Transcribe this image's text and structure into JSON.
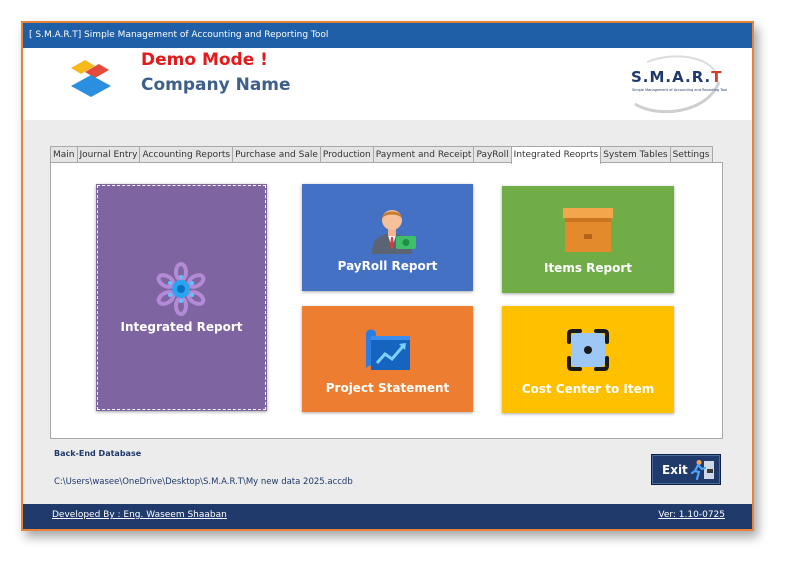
{
  "window": {
    "title": "[ S.M.A.R.T] Simple Management of Accounting and Reporting Tool"
  },
  "header": {
    "demo_text": "Demo Mode !",
    "company_name": "Company Name",
    "brand_logo_text": "S.M.A.R.T",
    "brand_logo_subtitle": "Simple Management of Accounting and Reporting Tool"
  },
  "tabs": [
    {
      "label": "Main"
    },
    {
      "label": "Journal Entry"
    },
    {
      "label": "Accounting Reports"
    },
    {
      "label": "Purchase and Sale"
    },
    {
      "label": "Production"
    },
    {
      "label": "Payment and Receipt"
    },
    {
      "label": "PayRoll"
    },
    {
      "label": "Integrated Reoprts",
      "active": true
    },
    {
      "label": "System Tables"
    },
    {
      "label": "Settings"
    }
  ],
  "tiles": {
    "integrated_report": {
      "label": "Integrated Report",
      "color": "#7e64a0",
      "icon": "flower-network-icon"
    },
    "payroll_report": {
      "label": "PayRoll Report",
      "color": "#4471c4",
      "icon": "person-money-icon"
    },
    "items_report": {
      "label": "Items Report",
      "color": "#70ad47",
      "icon": "box-icon"
    },
    "project_statement": {
      "label": "Project Statement",
      "color": "#ed7d31",
      "icon": "chart-scroll-icon"
    },
    "cost_center": {
      "label": "Cost Center to Item",
      "color": "#ffc000",
      "icon": "focus-frame-icon"
    }
  },
  "database": {
    "label": "Back-End Database",
    "path": "C:\\Users\\wasee\\OneDrive\\Desktop\\S.M.A.R.T\\My new data 2025.accdb"
  },
  "exit_button": {
    "label": "Exit"
  },
  "footer": {
    "developer": "Developed By : Eng. Waseem Shaaban",
    "version": "Ver: 1.10-0725"
  },
  "colors": {
    "titlebar": "#1f5fa8",
    "footer": "#1f3a6b",
    "demo_text": "#e21b1b",
    "window_border": "#e8833a"
  }
}
